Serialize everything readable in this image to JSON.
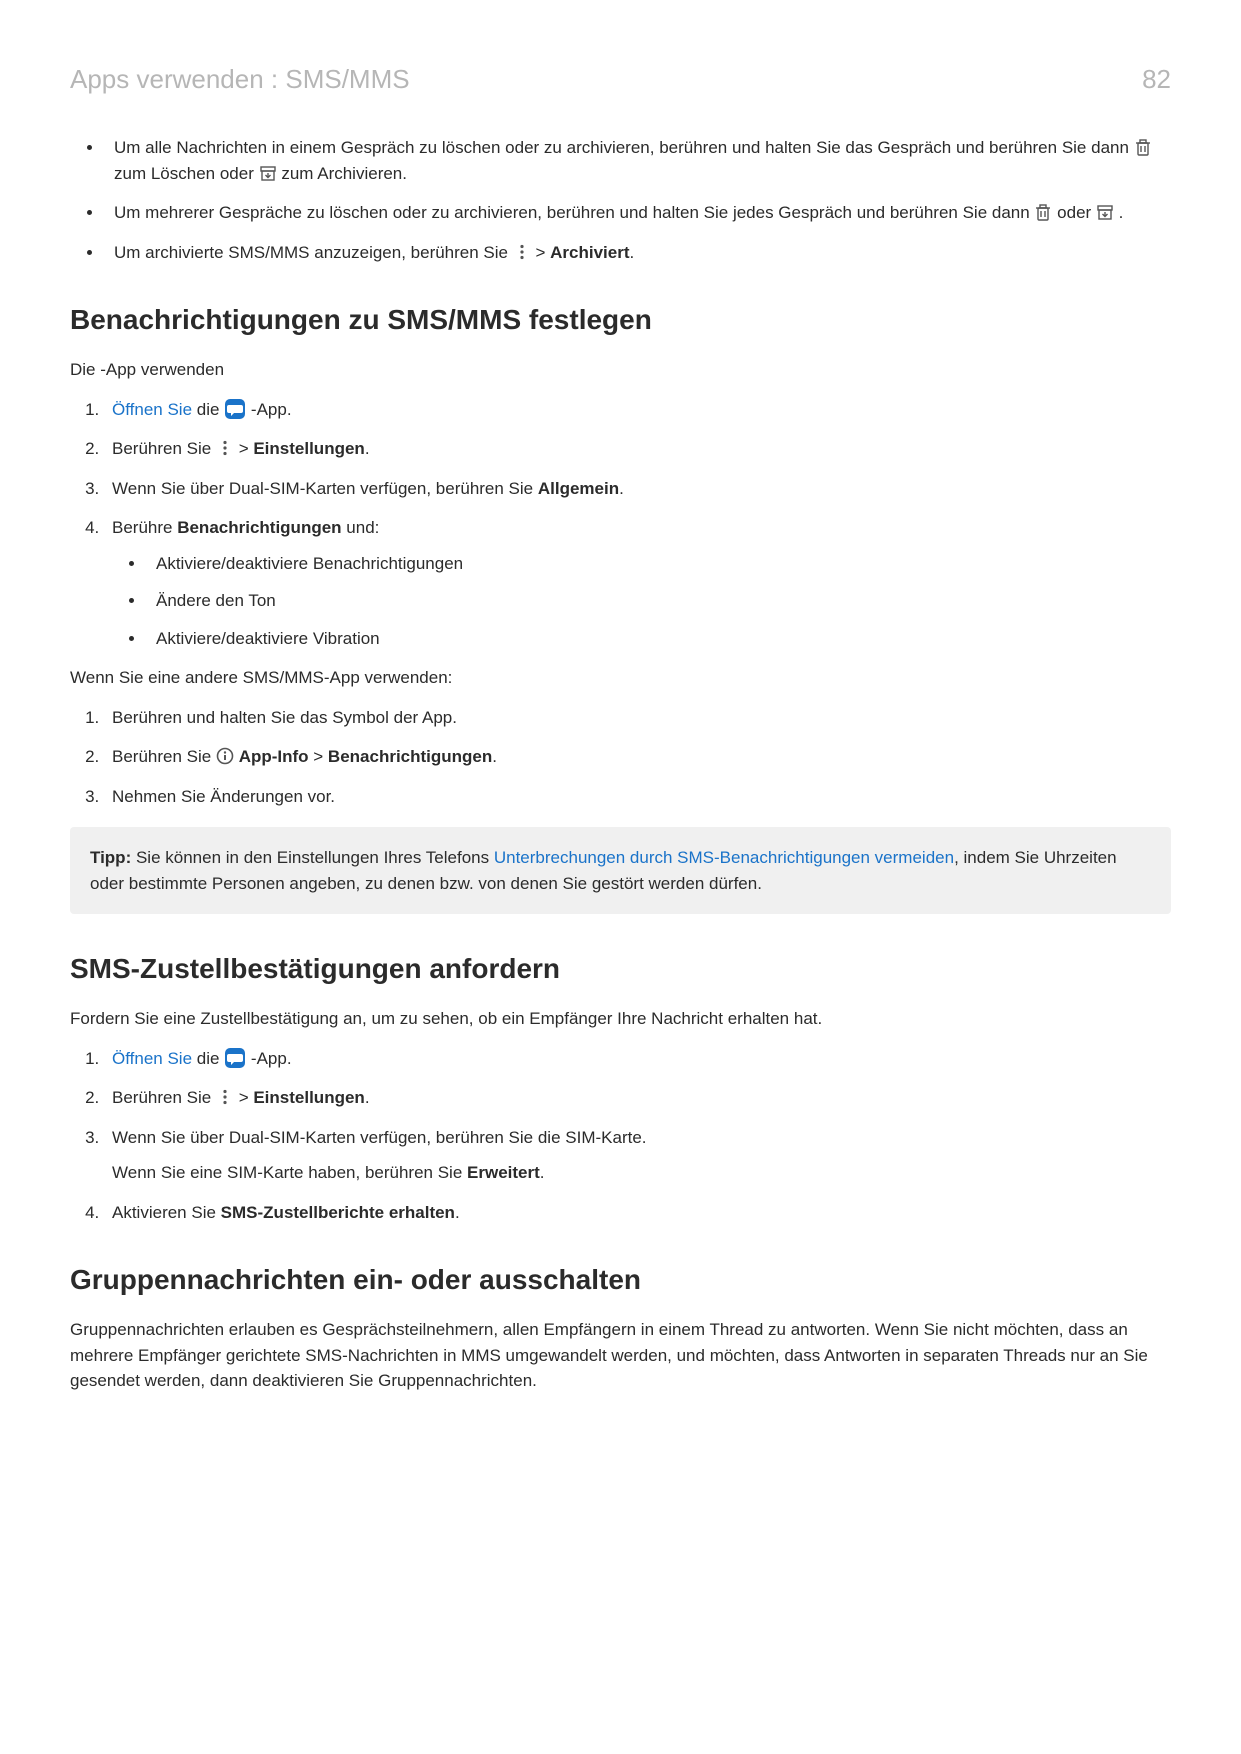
{
  "header": {
    "breadcrumb": "Apps verwenden : SMS/MMS",
    "page_number": "82"
  },
  "intro_bullets": {
    "b1_prefix": "Um alle Nachrichten in einem Gespräch zu löschen oder zu archivieren, berühren und halten Sie das Gespräch und berühren Sie dann ",
    "b1_mid1": " zum Löschen oder ",
    "b1_suffix": " zum Archivieren.",
    "b2_prefix": "Um mehrerer Gespräche zu löschen oder zu archivieren, berühren und halten Sie jedes Gespräch und berühren Sie dann ",
    "b2_mid": " oder ",
    "b2_suffix": ".",
    "b3_prefix": "Um archivierte SMS/MMS anzuzeigen, berühren Sie ",
    "b3_gt": " > ",
    "b3_strong": "Archiviert",
    "b3_suffix": "."
  },
  "section1": {
    "heading": "Benachrichtigungen zu SMS/MMS festlegen",
    "intro": "Die -App verwenden",
    "step1_link": "Öffnen Sie",
    "step1_mid": " die ",
    "step1_suffix": " -App.",
    "step2_prefix": "Berühren Sie ",
    "step2_gt": " > ",
    "step2_strong": "Einstellungen",
    "step2_suffix": ".",
    "step3_prefix": "Wenn Sie über Dual-SIM-Karten verfügen, berühren Sie ",
    "step3_strong": "Allgemein",
    "step3_suffix": ".",
    "step4_prefix": "Berühre ",
    "step4_strong": "Benachrichtigungen",
    "step4_suffix": " und:",
    "sub1": "Aktiviere/deaktiviere Benachrichtigungen",
    "sub2": "Ändere den Ton",
    "sub3": "Aktiviere/deaktiviere Vibration",
    "alt_intro": "Wenn Sie eine andere SMS/MMS-App verwenden:",
    "alt_step1": "Berühren und halten Sie das Symbol der App.",
    "alt_step2_prefix": "Berühren Sie ",
    "alt_step2_strong1": "App-Info",
    "alt_step2_gt": " > ",
    "alt_step2_strong2": "Benachrichtigungen",
    "alt_step2_suffix": ".",
    "alt_step3": "Nehmen Sie Änderungen vor."
  },
  "tip": {
    "label": "Tipp:",
    "text1": " Sie können in den Einstellungen Ihres Telefons ",
    "link": "Unterbrechungen durch SMS-Benachrichtigungen vermeiden",
    "text2": ", indem Sie Uhrzeiten oder bestimmte Personen angeben, zu denen bzw. von denen Sie gestört werden dürfen."
  },
  "section2": {
    "heading": "SMS-Zustellbestätigungen anfordern",
    "intro": "Fordern Sie eine Zustellbestätigung an, um zu sehen, ob ein Empfänger Ihre Nachricht erhalten hat.",
    "step1_link": "Öffnen Sie",
    "step1_mid": " die ",
    "step1_suffix": " -App.",
    "step2_prefix": "Berühren Sie ",
    "step2_gt": " > ",
    "step2_strong": "Einstellungen",
    "step2_suffix": ".",
    "step3a": "Wenn Sie über Dual-SIM-Karten verfügen, berühren Sie die SIM-Karte.",
    "step3b_prefix": "Wenn Sie eine SIM-Karte haben, berühren Sie ",
    "step3b_strong": "Erweitert",
    "step3b_suffix": ".",
    "step4_prefix": "Aktivieren Sie ",
    "step4_strong": "SMS-Zustellberichte erhalten",
    "step4_suffix": "."
  },
  "section3": {
    "heading": "Gruppennachrichten ein- oder ausschalten",
    "para": "Gruppennachrichten erlauben es Gesprächsteilnehmern, allen Empfängern in einem Thread zu antworten. Wenn Sie nicht möchten, dass an mehrere Empfänger gerichtete SMS-Nachrichten in MMS umgewandelt werden, und möchten, dass Antworten in separaten Threads nur an Sie gesendet werden, dann deaktivieren Sie Gruppennachrichten."
  }
}
